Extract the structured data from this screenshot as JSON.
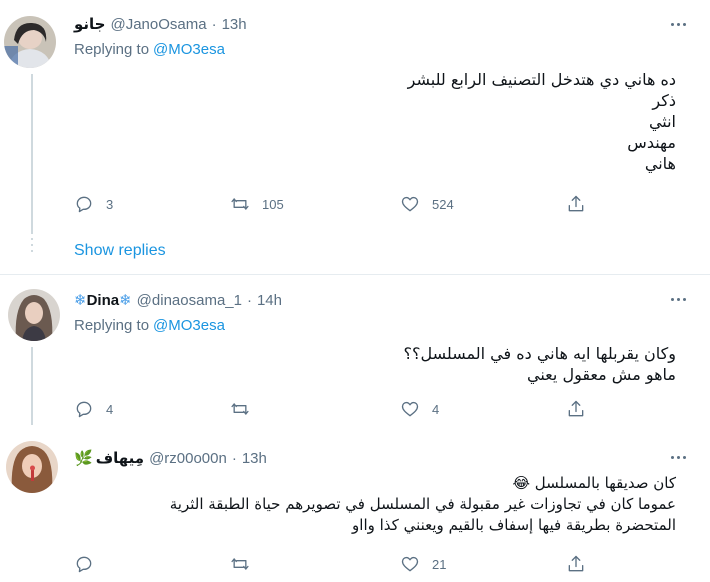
{
  "tweets": [
    {
      "name": "جانو",
      "handle": "@JanoOsama",
      "time": "13h",
      "replying_label": "Replying to",
      "replying_to": "@MO3esa",
      "text": "ده هاني دي هتدخل التصنيف الرابع للبشر\nذكر\nانثي\nمهندس\nهاني",
      "replies": "3",
      "retweets": "105",
      "likes": "524"
    },
    {
      "name": "Dina",
      "name_decor": "❄",
      "handle": "@dinaosama_1",
      "time": "14h",
      "replying_label": "Replying to",
      "replying_to": "@MO3esa",
      "text": "وكان يقربلها ايه هاني ده في المسلسل؟؟\nماهو مش معقول يعني",
      "replies": "4",
      "retweets": "",
      "likes": "4"
    },
    {
      "name": "مِيهاف",
      "name_decor": "🌿",
      "handle": "@rz00o00n",
      "time": "13h",
      "text": "كان صديقها بالمسلسل 😂\nعموما كان في تجاوزات غير مقبولة في المسلسل في تصويرهم حياة الطبقة الثرية\nالمتحضرة بطريقة فيها إسفاف بالقيم ويعنني  كذا وااو",
      "replies": "",
      "retweets": "",
      "likes": "21"
    }
  ],
  "show_replies": "Show replies",
  "separator": "·",
  "icons": {
    "reply": "reply-icon",
    "retweet": "retweet-icon",
    "like": "like-icon",
    "share": "share-icon",
    "more": "more-icon"
  },
  "colors": {
    "link": "#1b95e0",
    "muted": "#5b7083",
    "text": "#0f1419"
  }
}
